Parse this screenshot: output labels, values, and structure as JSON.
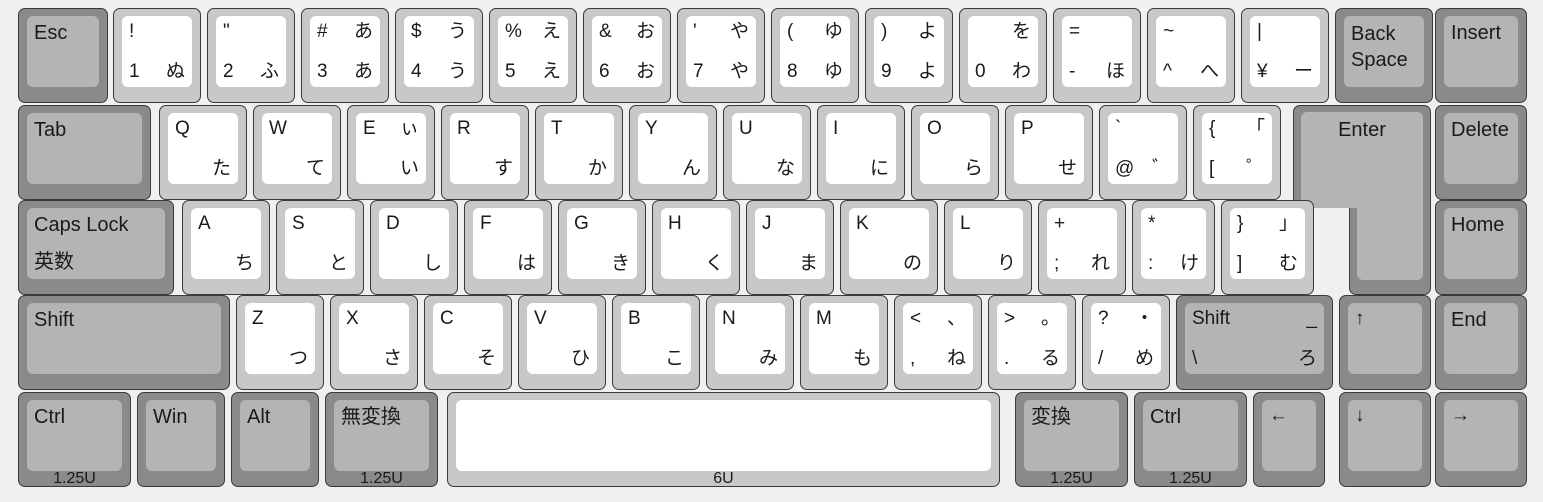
{
  "keyboard": {
    "title": "Japanese JIS Keyboard Layout",
    "colors": {
      "background": "#f0f0f0",
      "alpha_base": "#c8c8c8",
      "alpha_cap": "#ffffff",
      "mod_base": "#8a8a8a",
      "mod_cap": "#b4b4b4",
      "outline": "#3a3a3a",
      "legend": "#1a1a1a"
    },
    "rows": [
      {
        "name": "number-row",
        "keys": [
          {
            "name": "esc",
            "word": "Esc",
            "mod": true
          },
          {
            "name": "digit-1",
            "tl": "!",
            "tr": "",
            "bl": "1",
            "br": "ぬ"
          },
          {
            "name": "digit-2",
            "tl": "\"",
            "tr": "",
            "bl": "2",
            "br": "ふ"
          },
          {
            "name": "digit-3",
            "tl": "#",
            "tr": "あ",
            "bl": "3",
            "br": "あ"
          },
          {
            "name": "digit-4",
            "tl": "$",
            "tr": "う",
            "bl": "4",
            "br": "う"
          },
          {
            "name": "digit-5",
            "tl": "%",
            "tr": "え",
            "bl": "5",
            "br": "え"
          },
          {
            "name": "digit-6",
            "tl": "&",
            "tr": "お",
            "bl": "6",
            "br": "お"
          },
          {
            "name": "digit-7",
            "tl": "'",
            "tr": "や",
            "bl": "7",
            "br": "や"
          },
          {
            "name": "digit-8",
            "tl": "(",
            "tr": "ゆ",
            "bl": "8",
            "br": "ゆ"
          },
          {
            "name": "digit-9",
            "tl": ")",
            "tr": "よ",
            "bl": "9",
            "br": "よ"
          },
          {
            "name": "digit-0",
            "tl": "",
            "tr": "を",
            "bl": "0",
            "br": "わ"
          },
          {
            "name": "minus",
            "tl": "=",
            "tr": "",
            "bl": "-",
            "br": "ほ"
          },
          {
            "name": "caret",
            "tl": "~",
            "tr": "",
            "bl": "^",
            "br": "へ"
          },
          {
            "name": "yen",
            "tl": "|",
            "tr": "",
            "bl": "¥",
            "br": "ー"
          },
          {
            "name": "backspace",
            "word": "Back\nSpace",
            "mod": true
          },
          {
            "name": "insert",
            "word": "Insert",
            "mod": true
          }
        ]
      },
      {
        "name": "qwerty-row",
        "keys": [
          {
            "name": "tab",
            "word": "Tab",
            "mod": true
          },
          {
            "name": "key-q",
            "tl": "Q",
            "tr": "",
            "bl": "",
            "br": "た"
          },
          {
            "name": "key-w",
            "tl": "W",
            "tr": "",
            "bl": "",
            "br": "て"
          },
          {
            "name": "key-e",
            "tl": "E",
            "tr": "ぃ",
            "bl": "",
            "br": "い"
          },
          {
            "name": "key-r",
            "tl": "R",
            "tr": "",
            "bl": "",
            "br": "す"
          },
          {
            "name": "key-t",
            "tl": "T",
            "tr": "",
            "bl": "",
            "br": "か"
          },
          {
            "name": "key-y",
            "tl": "Y",
            "tr": "",
            "bl": "",
            "br": "ん"
          },
          {
            "name": "key-u",
            "tl": "U",
            "tr": "",
            "bl": "",
            "br": "な"
          },
          {
            "name": "key-i",
            "tl": "I",
            "tr": "",
            "bl": "",
            "br": "に"
          },
          {
            "name": "key-o",
            "tl": "O",
            "tr": "",
            "bl": "",
            "br": "ら"
          },
          {
            "name": "key-p",
            "tl": "P",
            "tr": "",
            "bl": "",
            "br": "せ"
          },
          {
            "name": "at",
            "tl": "`",
            "tr": "",
            "bl": "@",
            "br": "゛"
          },
          {
            "name": "bracket-left",
            "tl": "{",
            "tr": "「",
            "bl": "[",
            "br": "゜"
          },
          {
            "name": "enter",
            "word": "Enter",
            "mod": true,
            "shape": "iso-enter"
          },
          {
            "name": "delete",
            "word": "Delete",
            "mod": true
          }
        ]
      },
      {
        "name": "home-row",
        "keys": [
          {
            "name": "caps-lock",
            "word": "Caps Lock",
            "word2": "英数",
            "mod": true
          },
          {
            "name": "key-a",
            "tl": "A",
            "tr": "",
            "bl": "",
            "br": "ち"
          },
          {
            "name": "key-s",
            "tl": "S",
            "tr": "",
            "bl": "",
            "br": "と"
          },
          {
            "name": "key-d",
            "tl": "D",
            "tr": "",
            "bl": "",
            "br": "し"
          },
          {
            "name": "key-f",
            "tl": "F",
            "tr": "",
            "bl": "",
            "br": "は"
          },
          {
            "name": "key-g",
            "tl": "G",
            "tr": "",
            "bl": "",
            "br": "き"
          },
          {
            "name": "key-h",
            "tl": "H",
            "tr": "",
            "bl": "",
            "br": "く"
          },
          {
            "name": "key-j",
            "tl": "J",
            "tr": "",
            "bl": "",
            "br": "ま"
          },
          {
            "name": "key-k",
            "tl": "K",
            "tr": "",
            "bl": "",
            "br": "の"
          },
          {
            "name": "key-l",
            "tl": "L",
            "tr": "",
            "bl": "",
            "br": "り"
          },
          {
            "name": "semicolon",
            "tl": "+",
            "tr": "",
            "bl": ";",
            "br": "れ"
          },
          {
            "name": "colon",
            "tl": "*",
            "tr": "",
            "bl": ":",
            "br": "け"
          },
          {
            "name": "bracket-right",
            "tl": "}",
            "tr": "」",
            "bl": "]",
            "br": "む"
          },
          {
            "name": "home",
            "word": "Home",
            "mod": true
          }
        ]
      },
      {
        "name": "shift-row",
        "keys": [
          {
            "name": "shift-left",
            "word": "Shift",
            "mod": true
          },
          {
            "name": "key-z",
            "tl": "Z",
            "tr": "",
            "bl": "",
            "br": "つ"
          },
          {
            "name": "key-x",
            "tl": "X",
            "tr": "",
            "bl": "",
            "br": "さ"
          },
          {
            "name": "key-c",
            "tl": "C",
            "tr": "",
            "bl": "",
            "br": "そ"
          },
          {
            "name": "key-v",
            "tl": "V",
            "tr": "",
            "bl": "",
            "br": "ひ"
          },
          {
            "name": "key-b",
            "tl": "B",
            "tr": "",
            "bl": "",
            "br": "こ"
          },
          {
            "name": "key-n",
            "tl": "N",
            "tr": "",
            "bl": "",
            "br": "み"
          },
          {
            "name": "key-m",
            "tl": "M",
            "tr": "",
            "bl": "",
            "br": "も"
          },
          {
            "name": "comma",
            "tl": "<",
            "tr": "、",
            "bl": ",",
            "br": "ね"
          },
          {
            "name": "period",
            "tl": ">",
            "tr": "。",
            "bl": ".",
            "br": "る"
          },
          {
            "name": "slash",
            "tl": "?",
            "tr": "・",
            "bl": "/",
            "br": "め"
          },
          {
            "name": "shift-right",
            "tl": "Shift",
            "tr": "_",
            "bl": "\\",
            "br": "ろ",
            "mod": true
          },
          {
            "name": "arrow-up",
            "tl": "↑",
            "mod": true
          },
          {
            "name": "end",
            "word": "End",
            "mod": true
          }
        ]
      },
      {
        "name": "bottom-row",
        "keys": [
          {
            "name": "ctrl-left",
            "word": "Ctrl",
            "unit": "1.25U",
            "mod": true
          },
          {
            "name": "win",
            "word": "Win",
            "mod": true
          },
          {
            "name": "alt-left",
            "word": "Alt",
            "mod": true
          },
          {
            "name": "muhenkan",
            "word": "無変換",
            "unit": "1.25U",
            "mod": true
          },
          {
            "name": "space",
            "word": "",
            "unit": "6U"
          },
          {
            "name": "henkan",
            "word": "変換",
            "unit": "1.25U",
            "mod": true
          },
          {
            "name": "ctrl-right",
            "word": "Ctrl",
            "unit": "1.25U",
            "mod": true
          },
          {
            "name": "arrow-left",
            "tl": "←",
            "mod": true
          },
          {
            "name": "arrow-down",
            "tl": "↓",
            "mod": true
          },
          {
            "name": "arrow-right",
            "tl": "→",
            "mod": true
          }
        ]
      }
    ]
  }
}
